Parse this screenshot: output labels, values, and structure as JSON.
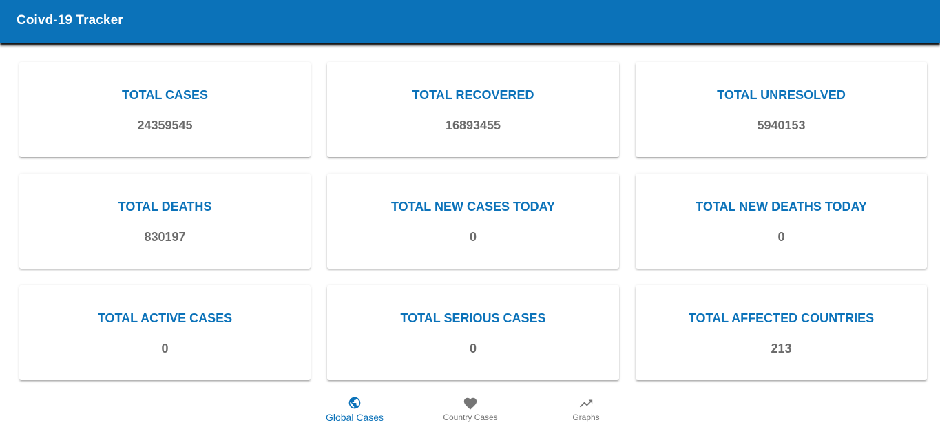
{
  "app": {
    "title": "Coivd-19 Tracker"
  },
  "colors": {
    "primary": "#0b72b9",
    "value_text": "#6b6b6b",
    "inactive_nav": "#757575"
  },
  "stats": [
    {
      "label": "TOTAL CASES",
      "value": "24359545"
    },
    {
      "label": "TOTAL RECOVERED",
      "value": "16893455"
    },
    {
      "label": "TOTAL UNRESOLVED",
      "value": "5940153"
    },
    {
      "label": "TOTAL DEATHS",
      "value": "830197"
    },
    {
      "label": "TOTAL NEW CASES TODAY",
      "value": "0"
    },
    {
      "label": "TOTAL NEW DEATHS TODAY",
      "value": "0"
    },
    {
      "label": "TOTAL ACTIVE CASES",
      "value": "0"
    },
    {
      "label": "TOTAL SERIOUS CASES",
      "value": "0"
    },
    {
      "label": "TOTAL AFFECTED COUNTRIES",
      "value": "213"
    }
  ],
  "bottom_nav": {
    "selected": "Global Cases",
    "items": [
      {
        "label": "Global Cases",
        "icon": "globe-icon"
      },
      {
        "label": "Country Cases",
        "icon": "heart-icon"
      },
      {
        "label": "Graphs",
        "icon": "trending-up-icon"
      }
    ]
  }
}
